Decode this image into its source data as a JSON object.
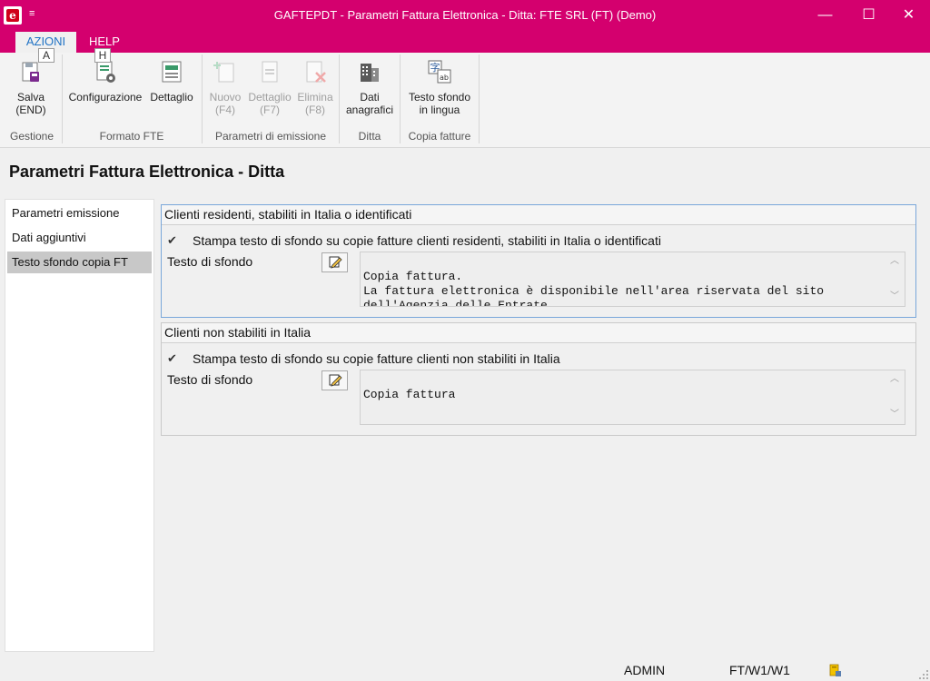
{
  "window": {
    "title": "GAFTEPDT - Parametri Fattura Elettronica - Ditta: FTE SRL (FT)  (Demo)",
    "qa_menu": "≡",
    "minimize": "—",
    "maximize": "☐",
    "close": "✕",
    "accent_color": "#d4006e"
  },
  "menu": {
    "tabs": [
      {
        "label": "AZIONI",
        "active": true
      },
      {
        "label": "HELP",
        "active": false
      }
    ],
    "keytips": {
      "help": "H",
      "azioni": "A"
    }
  },
  "ribbon": {
    "groups": [
      {
        "label": "Gestione"
      },
      {
        "label": "Formato FTE"
      },
      {
        "label": "Parametri di emissione"
      },
      {
        "label": "Ditta"
      },
      {
        "label": "Copia fatture"
      }
    ],
    "buttons": {
      "salva": {
        "line1": "Salva",
        "line2": "(END)",
        "icon": "save-icon"
      },
      "configurazione": {
        "line1": "Configurazione",
        "icon": "config-gear-icon"
      },
      "dettaglio": {
        "line1": "Dettaglio",
        "icon": "detail-list-icon"
      },
      "nuovo": {
        "line1": "Nuovo",
        "line2": "(F4)",
        "icon": "new-doc-icon",
        "disabled": true
      },
      "dettaglio_f7": {
        "line1": "Dettaglio",
        "line2": "(F7)",
        "icon": "doc-detail-icon",
        "disabled": true
      },
      "elimina": {
        "line1": "Elimina",
        "line2": "(F8)",
        "icon": "delete-doc-icon",
        "disabled": true
      },
      "dati_anagrafici": {
        "line1": "Dati",
        "line2": "anagrafici",
        "icon": "building-icon"
      },
      "testo_sfondo": {
        "line1": "Testo sfondo",
        "line2": "in lingua",
        "icon": "translate-icon"
      }
    }
  },
  "page": {
    "title": "Parametri Fattura Elettronica - Ditta"
  },
  "nav": {
    "items": [
      {
        "label": "Parametri emissione",
        "active": false
      },
      {
        "label": "Dati aggiuntivi",
        "active": false
      },
      {
        "label": "Testo sfondo copia FT",
        "active": true
      }
    ]
  },
  "sections": [
    {
      "title": "Clienti residenti, stabiliti in Italia o identificati",
      "checkbox_label": "Stampa testo di sfondo su copie fatture clienti residenti, stabiliti in Italia o identificati",
      "checked": true,
      "field_label": "Testo di sfondo",
      "text": "Copia fattura.\nLa fattura elettronica è disponibile nell'area riservata del sito\ndell'Agenzia delle Entrate."
    },
    {
      "title": "Clienti non stabiliti in Italia",
      "checkbox_label": "Stampa testo di sfondo su copie fatture clienti non stabiliti in Italia",
      "checked": true,
      "field_label": "Testo di sfondo",
      "text": "Copia fattura"
    }
  ],
  "status": {
    "user": "ADMIN",
    "location": "FT/W1/W1"
  }
}
